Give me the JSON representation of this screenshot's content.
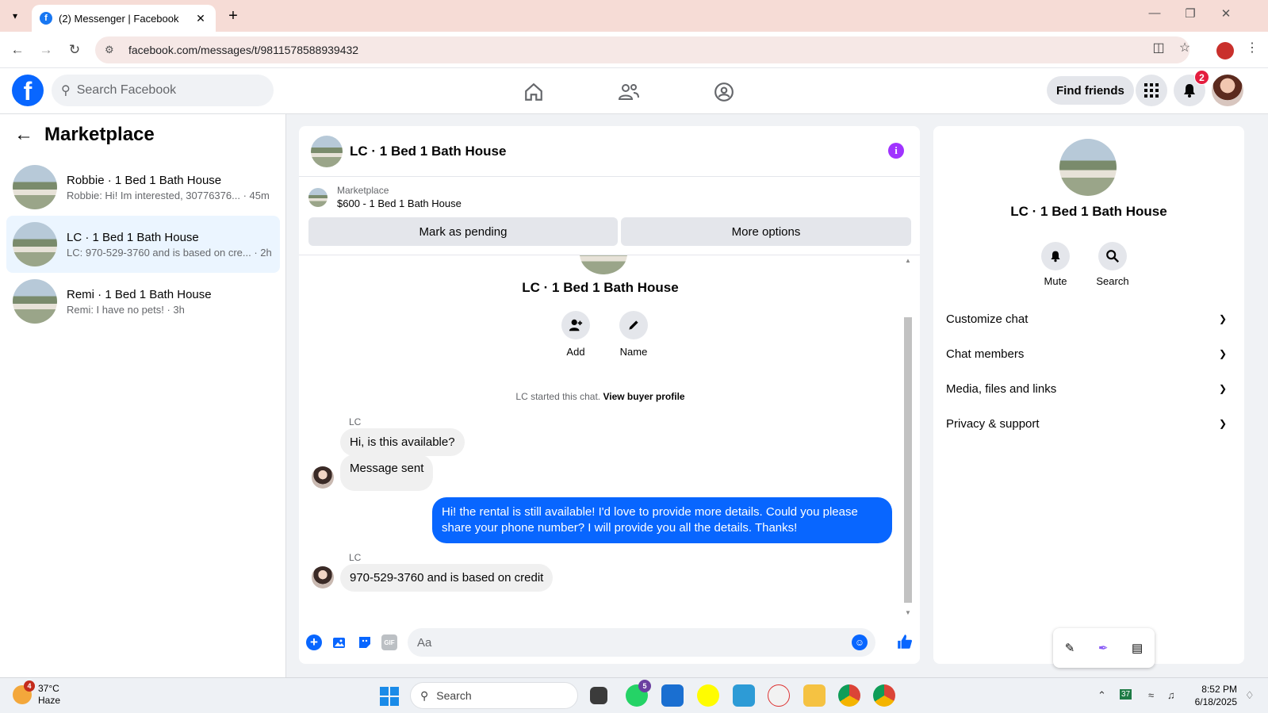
{
  "browser": {
    "tab_title": "(2) Messenger | Facebook",
    "url": "facebook.com/messages/t/9811578588939432"
  },
  "fb": {
    "search_placeholder": "Search Facebook",
    "find_friends": "Find friends",
    "notification_count": "2"
  },
  "sidebar": {
    "title": "Marketplace",
    "conversations": [
      {
        "name": "Robbie · 1 Bed 1 Bath House",
        "snippet": "Robbie: Hi! Im interested, 30776376... · 45m"
      },
      {
        "name": "LC · 1 Bed 1 Bath House",
        "snippet": "LC: 970-529-3760 and is based on cre... · 2h"
      },
      {
        "name": "Remi · 1 Bed 1 Bath House",
        "snippet": "Remi: I have no pets! · 3h"
      }
    ]
  },
  "chat": {
    "title": "LC · 1 Bed 1 Bath House",
    "marketplace_label": "Marketplace",
    "listing": "$600 - 1 Bed 1 Bath House",
    "mark_pending": "Mark as pending",
    "more_options": "More options",
    "thread_title": "LC · 1 Bed 1 Bath House",
    "add_label": "Add",
    "name_label": "Name",
    "started_text": "LC started this chat.",
    "view_buyer_profile": "View buyer profile",
    "messages": [
      {
        "sender": "LC",
        "text": "Hi, is this available?"
      },
      {
        "text": "Message sent"
      },
      {
        "text": "Hi! the rental is still available! I'd love to provide more details. Could you please share your phone number? I will provide you all the details. Thanks!"
      },
      {
        "sender": "LC",
        "text": "970-529-3760 and is based on credit"
      }
    ],
    "composer_placeholder": "Aa"
  },
  "details": {
    "title": "LC · 1 Bed 1 Bath House",
    "mute": "Mute",
    "search": "Search",
    "sections": [
      "Customize chat",
      "Chat members",
      "Media, files and links",
      "Privacy & support"
    ]
  },
  "taskbar": {
    "temp": "37°C",
    "weather": "Haze",
    "weather_badge": "4",
    "search": "Search",
    "whatsapp_badge": "5",
    "time": "8:52 PM",
    "date": "6/18/2025",
    "tray_count": "37"
  }
}
